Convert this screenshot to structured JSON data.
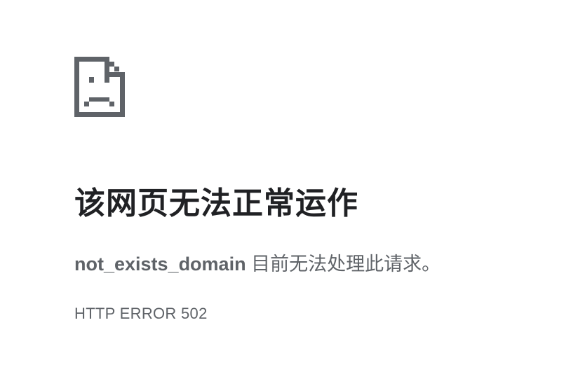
{
  "page": {
    "icon": "sad-page-icon",
    "title": "该网页无法正常运作",
    "domain": "not_exists_domain",
    "message": " 目前无法处理此请求。",
    "error_code": "HTTP ERROR 502"
  },
  "colors": {
    "background": "#ffffff",
    "title": "#202124",
    "text": "#5f6368",
    "icon": "#5f6368"
  }
}
